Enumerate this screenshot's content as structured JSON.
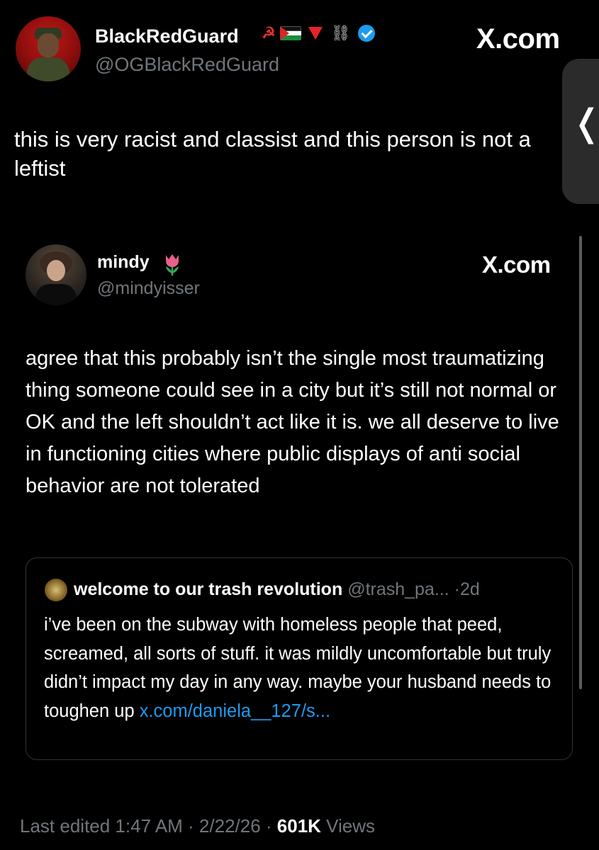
{
  "tweet": {
    "author_name": "BlackRedGuard",
    "author_handle": "@OGBlackRedGuard",
    "source_label": "X.com",
    "text": "this is very racist and classist and this person is not a leftist",
    "name_emojis": [
      "hammer-and-sickle",
      "palestine-flag",
      "red-triangle",
      "broken-chain",
      "verified-badge"
    ],
    "emoji_hammer_sickle": "☭",
    "emoji_chain": "⛓"
  },
  "quoted_tweet": {
    "author_name": "mindy",
    "author_handle": "@mindyisser",
    "source_label": "X.com",
    "text": "agree that this probably isn’t the single most traumatizing thing someone could see in a city but it’s still not normal or OK and the left shouldn’t act like it is. we all deserve to live in functioning cities where public displays of anti social behavior are not tolerated"
  },
  "nested_quote": {
    "author_name": "welcome to our trash revolution",
    "author_handle": "@trash_pa...",
    "separator": "·",
    "time": "2d",
    "text": "i’ve been on the subway with homeless people that peed, screamed, all sorts of stuff. it was mildly uncomfortable but truly didn’t impact my day in any way. maybe your husband needs to toughen up ",
    "link": "x.com/daniela__127/s..."
  },
  "footer": {
    "edited_label": "Last edited 1:47 AM · 2/22/26 · ",
    "views_count": "601K",
    "views_label": " Views"
  },
  "ui": {
    "side_tab_chevron": "❬"
  },
  "colors": {
    "background": "#000000",
    "text_primary": "#ffffff",
    "text_secondary": "#71767b",
    "link": "#1d9bf0",
    "verified": "#1d9bf0",
    "card_border": "#2f3336"
  }
}
